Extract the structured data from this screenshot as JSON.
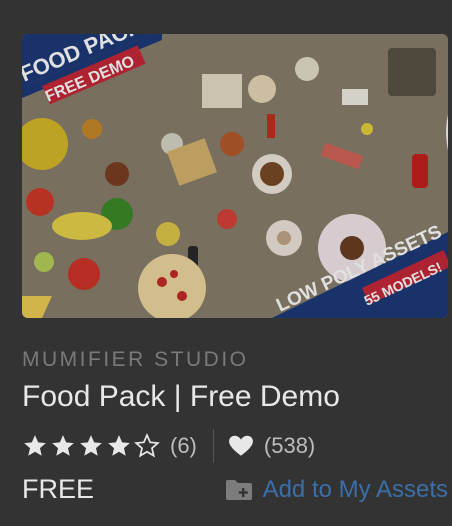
{
  "asset": {
    "banner_title_line1": "FOOD PACK",
    "banner_title_line2": "FREE DEMO",
    "banner_footer_line1": "LOW POLY ASSETS",
    "banner_footer_line2": "55 MODELS!",
    "publisher": "MUMIFIER STUDIO",
    "title": "Food Pack | Free Demo",
    "rating_stars": 4,
    "rating_max": 5,
    "rating_count": "(6)",
    "favorites_count": "(538)",
    "price": "FREE",
    "add_label": "Add to My Assets"
  },
  "icons": {
    "favorite": "heart-outline-icon",
    "star_full": "star-icon",
    "star_empty": "star-outline-icon",
    "favorites": "heart-icon",
    "add": "folder-add-icon"
  },
  "colors": {
    "background": "#333333",
    "link": "#3b6fa8",
    "publisher": "#7a7a7a",
    "banner_blue": "#1d3a78",
    "banner_red": "#c7283a"
  }
}
